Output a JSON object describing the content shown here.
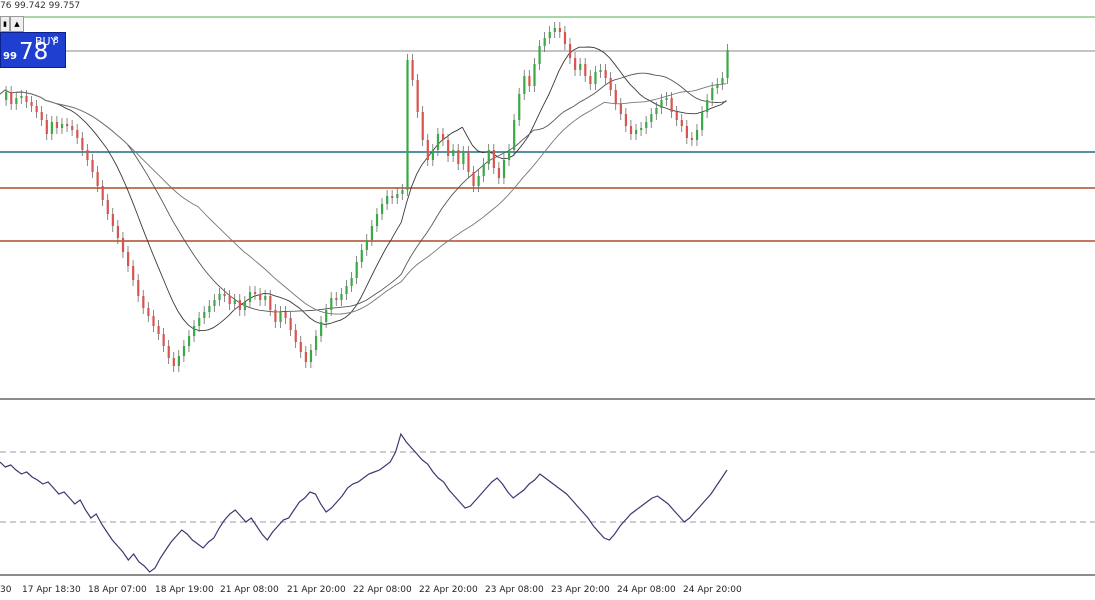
{
  "quote_strip": "76 99.742 99.757",
  "trade_panel": {
    "left_button": "▮",
    "arrow_button": "▲",
    "buy_label": "BUY",
    "price_small": "99",
    "price_big": "78",
    "price_sup": "8"
  },
  "time_axis": {
    "labels": [
      "30",
      "17 Apr 18:30",
      "18 Apr 07:00",
      "18 Apr 19:00",
      "21 Apr 08:00",
      "21 Apr 20:00",
      "22 Apr 08:00",
      "22 Apr 20:00",
      "23 Apr 08:00",
      "23 Apr 20:00",
      "24 Apr 08:00",
      "24 Apr 20:00"
    ]
  },
  "colors": {
    "bull": "#39a845",
    "bear": "#d9534f",
    "ma_line": "#3a3a3a",
    "osc_line": "#3a3a72",
    "level_teal": "#1f6f86",
    "level_red": "#b04a2a",
    "level_green": "#4caf50",
    "buy_bg": "#1f3fd0"
  },
  "chart_data": {
    "type": "candlestick",
    "levels": [
      {
        "kind": "horizontal-line",
        "color": "green"
      },
      {
        "kind": "horizontal-line",
        "color": "gray"
      },
      {
        "kind": "horizontal-line",
        "color": "teal"
      },
      {
        "kind": "horizontal-line",
        "color": "red"
      },
      {
        "kind": "horizontal-line",
        "color": "red"
      }
    ],
    "close_path": [
      [
        0,
        100
      ],
      [
        2,
        92
      ],
      [
        4,
        104
      ],
      [
        6,
        98
      ],
      [
        8,
        96
      ],
      [
        10,
        102
      ],
      [
        12,
        106
      ],
      [
        14,
        112
      ],
      [
        16,
        120
      ],
      [
        18,
        134
      ],
      [
        20,
        122
      ],
      [
        22,
        128
      ],
      [
        24,
        124
      ],
      [
        26,
        126
      ],
      [
        28,
        130
      ],
      [
        30,
        138
      ],
      [
        32,
        150
      ],
      [
        34,
        160
      ],
      [
        36,
        172
      ],
      [
        38,
        186
      ],
      [
        40,
        200
      ],
      [
        42,
        214
      ],
      [
        44,
        226
      ],
      [
        46,
        238
      ],
      [
        48,
        252
      ],
      [
        50,
        266
      ],
      [
        52,
        280
      ],
      [
        54,
        296
      ],
      [
        56,
        308
      ],
      [
        58,
        316
      ],
      [
        60,
        326
      ],
      [
        62,
        334
      ],
      [
        64,
        346
      ],
      [
        66,
        358
      ],
      [
        68,
        366
      ],
      [
        70,
        356
      ],
      [
        72,
        346
      ],
      [
        74,
        336
      ],
      [
        76,
        326
      ],
      [
        78,
        318
      ],
      [
        80,
        312
      ],
      [
        82,
        306
      ],
      [
        84,
        300
      ],
      [
        86,
        294
      ],
      [
        88,
        296
      ],
      [
        90,
        304
      ],
      [
        92,
        300
      ],
      [
        94,
        310
      ],
      [
        96,
        302
      ],
      [
        98,
        292
      ],
      [
        100,
        294
      ],
      [
        102,
        300
      ],
      [
        104,
        296
      ],
      [
        106,
        310
      ],
      [
        108,
        322
      ],
      [
        110,
        312
      ],
      [
        112,
        318
      ],
      [
        114,
        330
      ],
      [
        116,
        342
      ],
      [
        118,
        352
      ],
      [
        120,
        362
      ],
      [
        122,
        350
      ],
      [
        124,
        336
      ],
      [
        126,
        322
      ],
      [
        128,
        310
      ],
      [
        130,
        298
      ],
      [
        132,
        300
      ],
      [
        134,
        294
      ],
      [
        136,
        286
      ],
      [
        138,
        278
      ],
      [
        140,
        262
      ],
      [
        142,
        250
      ],
      [
        144,
        240
      ],
      [
        146,
        226
      ],
      [
        148,
        214
      ],
      [
        150,
        204
      ],
      [
        152,
        196
      ],
      [
        154,
        198
      ],
      [
        156,
        194
      ],
      [
        158,
        190
      ],
      [
        160,
        60
      ],
      [
        162,
        80
      ],
      [
        164,
        112
      ],
      [
        166,
        140
      ],
      [
        168,
        160
      ],
      [
        170,
        150
      ],
      [
        172,
        134
      ],
      [
        174,
        140
      ],
      [
        176,
        156
      ],
      [
        178,
        150
      ],
      [
        180,
        164
      ],
      [
        182,
        152
      ],
      [
        184,
        172
      ],
      [
        186,
        186
      ],
      [
        188,
        176
      ],
      [
        190,
        164
      ],
      [
        192,
        150
      ],
      [
        194,
        168
      ],
      [
        196,
        178
      ],
      [
        198,
        160
      ],
      [
        200,
        150
      ],
      [
        202,
        120
      ],
      [
        204,
        94
      ],
      [
        206,
        76
      ],
      [
        208,
        86
      ],
      [
        210,
        64
      ],
      [
        212,
        46
      ],
      [
        214,
        38
      ],
      [
        216,
        32
      ],
      [
        218,
        28
      ],
      [
        220,
        32
      ],
      [
        222,
        44
      ],
      [
        224,
        58
      ],
      [
        226,
        70
      ],
      [
        228,
        64
      ],
      [
        230,
        76
      ],
      [
        232,
        84
      ],
      [
        234,
        72
      ],
      [
        236,
        70
      ],
      [
        238,
        78
      ],
      [
        240,
        90
      ],
      [
        242,
        104
      ],
      [
        244,
        114
      ],
      [
        246,
        126
      ],
      [
        248,
        134
      ],
      [
        250,
        130
      ],
      [
        252,
        128
      ],
      [
        254,
        122
      ],
      [
        256,
        114
      ],
      [
        258,
        108
      ],
      [
        260,
        100
      ],
      [
        262,
        98
      ],
      [
        264,
        112
      ],
      [
        266,
        120
      ],
      [
        268,
        126
      ],
      [
        270,
        138
      ],
      [
        272,
        140
      ],
      [
        274,
        130
      ],
      [
        276,
        112
      ],
      [
        278,
        100
      ],
      [
        280,
        88
      ],
      [
        282,
        84
      ],
      [
        284,
        78
      ],
      [
        286,
        50
      ]
    ],
    "close_path_units": "relative-index-vs-price-pixels-unlabeled"
  }
}
